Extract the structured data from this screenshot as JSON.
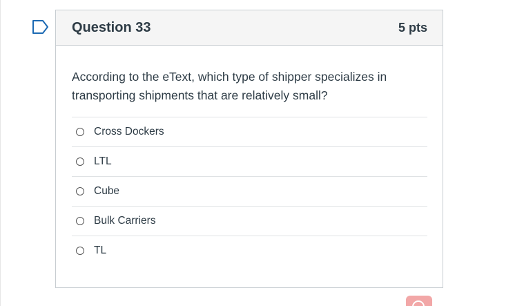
{
  "question": {
    "title": "Question 33",
    "points": "5 pts",
    "text": "According to the eText, which type of shipper specializes in transporting shipments that are relatively small?",
    "answers": [
      "Cross Dockers",
      "LTL",
      "Cube",
      "Bulk Carriers",
      "TL"
    ]
  },
  "icons": {
    "flag": "bookmark-flag-icon",
    "radio": "radio-circle-icon",
    "corner": "chat-bubble-icon"
  },
  "colors": {
    "text": "#2d3b45",
    "border": "#c7cdd1",
    "header_bg": "#f5f5f5",
    "flag": "#1b69b3",
    "corner_button": "#f2a7a7"
  }
}
